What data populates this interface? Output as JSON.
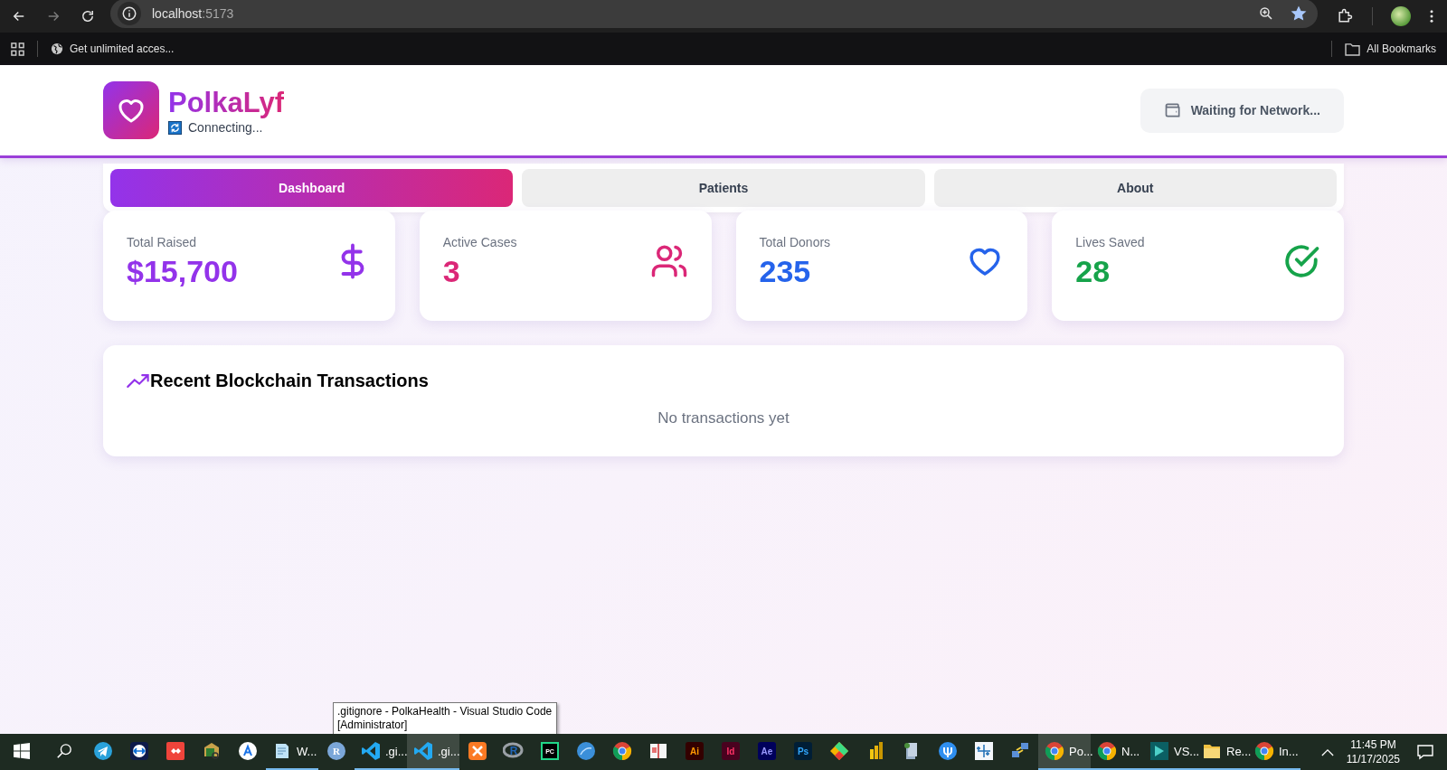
{
  "browser": {
    "nav": [
      {
        "kind": "back",
        "disabled": false
      },
      {
        "kind": "forward",
        "disabled": true
      },
      {
        "kind": "reload",
        "disabled": false
      }
    ],
    "address": {
      "host": "localhost",
      "port": ":5173"
    },
    "bookmarked": true,
    "bookmarks": [
      {
        "label": "Get unlimited acces..."
      }
    ],
    "all_bookmarks": "All Bookmarks"
  },
  "header": {
    "brand": "PolkaLyf",
    "status": "Connecting...",
    "wallet_button": "Waiting for Network..."
  },
  "tabs": [
    {
      "label": "Dashboard",
      "selected": true
    },
    {
      "label": "Patients",
      "selected": false
    },
    {
      "label": "About",
      "selected": false
    }
  ],
  "stats": [
    {
      "kind": "dollar",
      "label": "Total Raised",
      "value": "$15,700",
      "color": "#9333ea"
    },
    {
      "kind": "users",
      "label": "Active Cases",
      "value": "3",
      "color": "#db2777"
    },
    {
      "kind": "heart",
      "label": "Total Donors",
      "value": "235",
      "color": "#2563eb"
    },
    {
      "kind": "check",
      "label": "Lives Saved",
      "value": "28",
      "color": "#16a34a"
    }
  ],
  "transactions": {
    "title": "Recent Blockchain Transactions",
    "empty": "No transactions yet"
  },
  "tooltip": {
    "text": ".gitignore - PolkaHealth - Visual Studio Code [Administrator]"
  },
  "taskbar": {
    "items": [
      {
        "kind": "telegram",
        "running": false,
        "selected": false
      },
      {
        "kind": "teamviewer",
        "running": false,
        "selected": false
      },
      {
        "kind": "anydesk",
        "running": false,
        "selected": false
      },
      {
        "kind": "mail",
        "running": false,
        "selected": false
      },
      {
        "kind": "appstore",
        "running": false,
        "selected": false
      },
      {
        "kind": "notepad",
        "label": "W...",
        "running": true,
        "selected": false
      },
      {
        "kind": "circle",
        "glyph": "R",
        "running": false,
        "selected": false
      },
      {
        "kind": "vscode",
        "label": ".gi...",
        "running": true,
        "selected": false
      },
      {
        "kind": "vscode",
        "label": ".gi...",
        "running": true,
        "selected": true
      },
      {
        "kind": "xampp",
        "running": false,
        "selected": false
      },
      {
        "kind": "rlang",
        "glyph": "R",
        "running": false,
        "selected": false
      },
      {
        "kind": "pycharm",
        "glyph": "PC",
        "running": false,
        "selected": false
      },
      {
        "kind": "browser",
        "running": false,
        "selected": false
      },
      {
        "kind": "chrome",
        "running": false,
        "selected": false
      },
      {
        "kind": "book",
        "running": false,
        "selected": false
      },
      {
        "kind": "ai",
        "glyph": "Ai",
        "running": false,
        "selected": false
      },
      {
        "kind": "id",
        "glyph": "Id",
        "running": false,
        "selected": false
      },
      {
        "kind": "ae",
        "glyph": "Ae",
        "running": false,
        "selected": false
      },
      {
        "kind": "ps",
        "glyph": "Ps",
        "running": false,
        "selected": false
      },
      {
        "kind": "diamond",
        "running": false,
        "selected": false
      },
      {
        "kind": "bars",
        "running": false,
        "selected": false
      },
      {
        "kind": "computer",
        "running": false,
        "selected": false
      },
      {
        "kind": "pcloud",
        "running": false,
        "selected": false
      },
      {
        "kind": "tableau",
        "running": false,
        "selected": false
      },
      {
        "kind": "network",
        "running": false,
        "selected": false
      },
      {
        "kind": "chrome",
        "label": "Po...",
        "running": true,
        "selected": true
      },
      {
        "kind": "chrome",
        "label": "N...",
        "running": true,
        "selected": false
      },
      {
        "kind": "player",
        "label": "VS...",
        "running": true,
        "selected": false
      },
      {
        "kind": "folder",
        "label": "Re...",
        "running": true,
        "selected": false
      },
      {
        "kind": "chrome",
        "label": "In...",
        "running": true,
        "selected": false
      }
    ],
    "clock": {
      "time": "11:45 PM",
      "date": "11/17/2025"
    }
  }
}
